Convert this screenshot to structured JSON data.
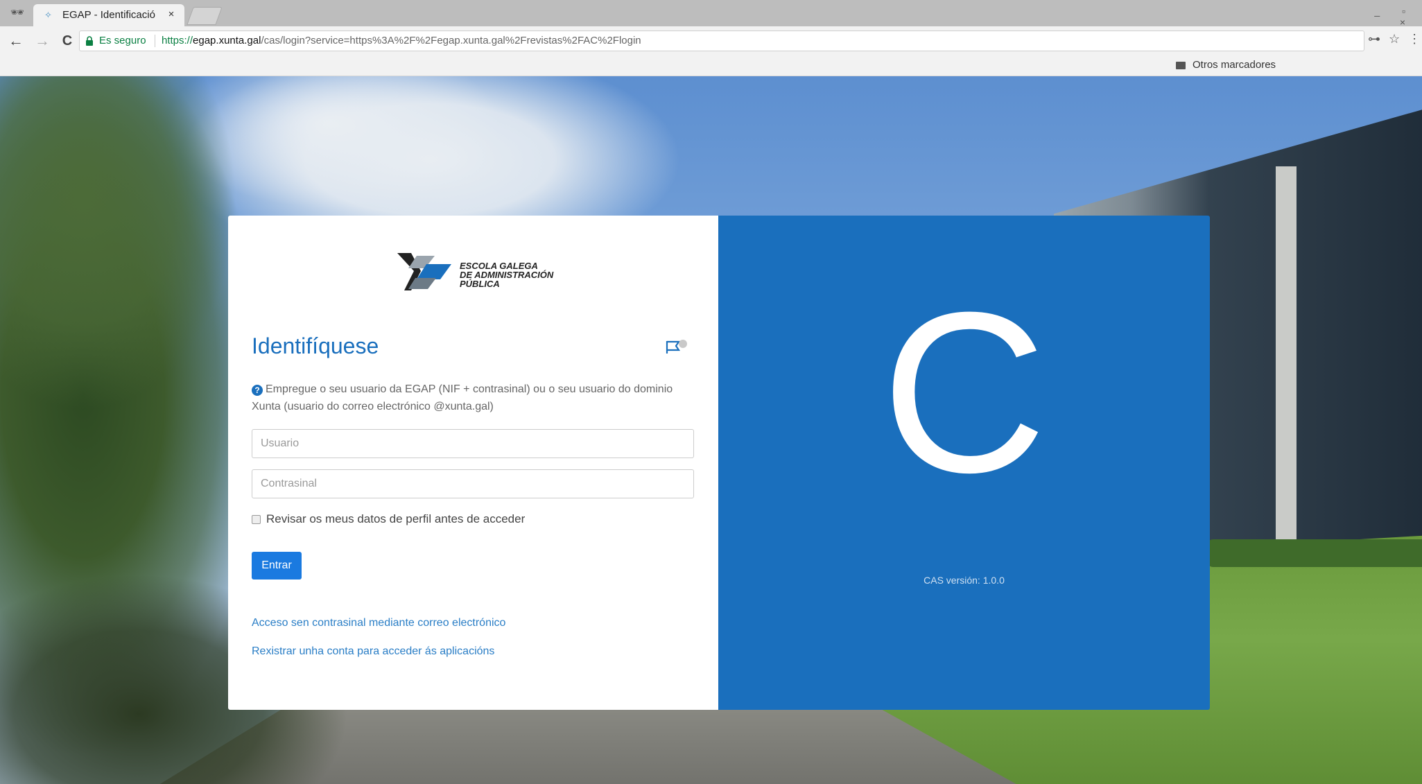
{
  "browser": {
    "tab": {
      "title": "EGAP - Identificació",
      "close": "×"
    },
    "window_controls": "_ ▫ ×",
    "nav": {
      "back": "←",
      "forward": "→",
      "reload": "C"
    },
    "address": {
      "secure_label": "Es seguro",
      "url_scheme": "https://",
      "url_host": "egap.xunta.gal",
      "url_path": "/cas/login?service=https%3A%2F%2Fegap.xunta.gal%2Frevistas%2FAC%2Flogin"
    },
    "toolbar_icons": {
      "key": "⊶",
      "star": "☆",
      "menu": "⋮"
    },
    "bookmarks": {
      "other_label": "Otros marcadores"
    }
  },
  "login": {
    "logo_lines": [
      "ESCOLA GALEGA",
      "DE ADMINISTRACIÓN",
      "PÚBLICA"
    ],
    "title": "Identifíquese",
    "help_text": "Empregue o seu usuario da EGAP (NIF + contrasinal) ou o seu usuario do dominio Xunta (usuario do correo electrónico @xunta.gal)",
    "username_placeholder": "Usuario",
    "password_placeholder": "Contrasinal",
    "review_checkbox_label": "Revisar os meus datos de perfil antes de acceder",
    "submit_label": "Entrar",
    "links": {
      "passwordless": "Acceso sen contrasinal mediante correo electrónico",
      "register": "Rexistrar unha conta para acceder ás aplicacións"
    }
  },
  "brand_panel": {
    "letter": "C",
    "version": "CAS versión: 1.0.0"
  },
  "colors": {
    "primary": "#1a6fbd",
    "button": "#1a7ae0",
    "link": "#2a7ec6"
  }
}
